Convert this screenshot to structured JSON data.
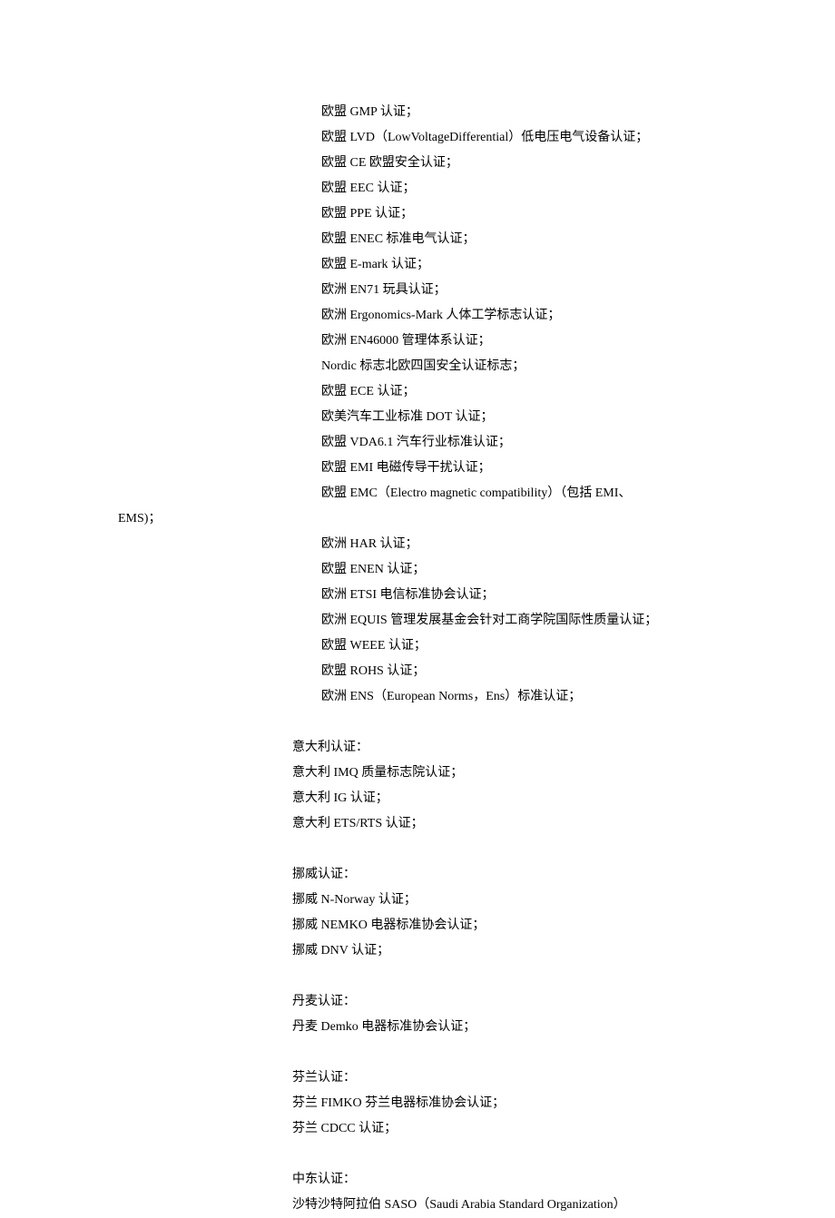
{
  "lines": [
    {
      "cls": "indent1",
      "text": "欧盟 GMP 认证；"
    },
    {
      "cls": "indent1",
      "text": "欧盟 LVD（LowVoltageDifferential）低电压电气设备认证；"
    },
    {
      "cls": "indent1",
      "text": "欧盟 CE 欧盟安全认证；"
    },
    {
      "cls": "indent1",
      "text": "欧盟 EEC 认证；"
    },
    {
      "cls": "indent1",
      "text": "欧盟 PPE 认证；"
    },
    {
      "cls": "indent1",
      "text": "欧盟 ENEC 标准电气认证；"
    },
    {
      "cls": "indent1",
      "text": "欧盟 E-mark 认证；"
    },
    {
      "cls": "indent1",
      "text": "欧洲 EN71 玩具认证；"
    },
    {
      "cls": "indent1",
      "text": "欧洲 Ergonomics-Mark 人体工学标志认证；"
    },
    {
      "cls": "indent1",
      "text": "欧洲 EN46000 管理体系认证；"
    },
    {
      "cls": "indent1",
      "text": "Nordic 标志北欧四国安全认证标志；"
    },
    {
      "cls": "indent1",
      "text": "欧盟 ECE 认证；"
    },
    {
      "cls": "indent1",
      "text": "欧美汽车工业标准 DOT 认证；"
    },
    {
      "cls": "indent1",
      "text": "欧盟 VDA6.1 汽车行业标准认证；"
    },
    {
      "cls": "indent1",
      "text": "欧盟 EMI 电磁传导干扰认证；"
    },
    {
      "cls": "indent1",
      "text": "欧盟 EMC（Electro magnetic compatibility）（包括 EMI、"
    },
    {
      "cls": "indent0",
      "text": "EMS)；"
    },
    {
      "cls": "indent1",
      "text": "欧洲 HAR 认证；"
    },
    {
      "cls": "indent1",
      "text": "欧盟 ENEN 认证；"
    },
    {
      "cls": "indent1",
      "text": "欧洲 ETSI 电信标准协会认证；"
    },
    {
      "cls": "indent1",
      "text": "欧洲 EQUIS 管理发展基金会针对工商学院国际性质量认证；"
    },
    {
      "cls": "indent1",
      "text": "欧盟 WEEE 认证；"
    },
    {
      "cls": "indent1",
      "text": "欧盟 ROHS 认证；"
    },
    {
      "cls": "indent1",
      "text": "欧洲 ENS（European Norms，Ens）标准认证；"
    },
    {
      "cls": "blank",
      "text": ""
    },
    {
      "cls": "indent-section",
      "text": "意大利认证："
    },
    {
      "cls": "indent-section",
      "text": "意大利 IMQ 质量标志院认证；"
    },
    {
      "cls": "indent-section",
      "text": "意大利 IG 认证；"
    },
    {
      "cls": "indent-section",
      "text": "意大利 ETS/RTS 认证；"
    },
    {
      "cls": "blank",
      "text": ""
    },
    {
      "cls": "indent-section",
      "text": "挪威认证："
    },
    {
      "cls": "indent-section",
      "text": "挪威 N-Norway 认证；"
    },
    {
      "cls": "indent-section",
      "text": "挪威 NEMKO 电器标准协会认证；"
    },
    {
      "cls": "indent-section",
      "text": "挪威 DNV 认证；"
    },
    {
      "cls": "blank",
      "text": ""
    },
    {
      "cls": "indent-section",
      "text": "丹麦认证："
    },
    {
      "cls": "indent-section",
      "text": "丹麦 Demko 电器标准协会认证；"
    },
    {
      "cls": "blank",
      "text": ""
    },
    {
      "cls": "indent-section",
      "text": "芬兰认证："
    },
    {
      "cls": "indent-section",
      "text": "芬兰 FIMKO 芬兰电器标准协会认证；"
    },
    {
      "cls": "indent-section",
      "text": "芬兰 CDCC 认证；"
    },
    {
      "cls": "blank",
      "text": ""
    },
    {
      "cls": "indent-section",
      "text": "中东认证："
    },
    {
      "cls": "indent-section",
      "text": "沙特沙特阿拉伯 SASO（Saudi Arabia Standard Organization）"
    }
  ]
}
